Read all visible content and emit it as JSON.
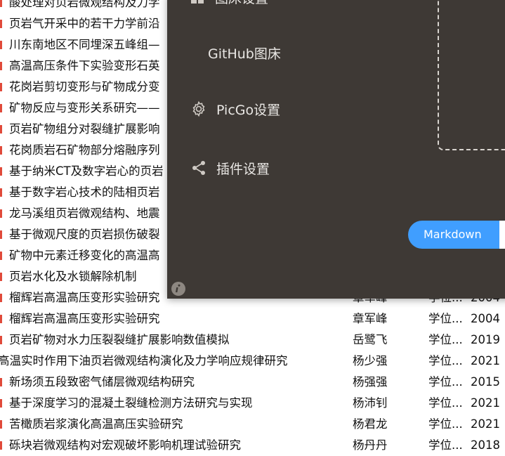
{
  "records": [
    {
      "title": "酸处理对页岩微观结构及力学",
      "author": "",
      "type": "",
      "year": "",
      "partial": true
    },
    {
      "title": "页岩气开采中的若干力学前沿",
      "author": "",
      "type": "",
      "year": "",
      "partial": true
    },
    {
      "title": "川东南地区不同埋深五峰组—",
      "author": "",
      "type": "",
      "year": "",
      "partial": true
    },
    {
      "title": "高温高压条件下实验变形石英",
      "author": "",
      "type": "",
      "year": "",
      "partial": true
    },
    {
      "title": "花岗岩剪切变形与矿物成分变",
      "author": "",
      "type": "",
      "year": "",
      "partial": true
    },
    {
      "title": "矿物反应与变形关系研究——",
      "author": "",
      "type": "",
      "year": "",
      "partial": true
    },
    {
      "title": "页岩矿物组分对裂缝扩展影响",
      "author": "",
      "type": "",
      "year": "",
      "partial": true
    },
    {
      "title": "花岗质岩石矿物部分熔融序列",
      "author": "",
      "type": "",
      "year": "",
      "partial": true
    },
    {
      "title": "基于纳米CT及数字岩心的页岩",
      "author": "",
      "type": "",
      "year": "",
      "partial": true
    },
    {
      "title": "基于数字岩心技术的陆相页岩",
      "author": "",
      "type": "",
      "year": "",
      "partial": true
    },
    {
      "title": "龙马溪组页岩微观结构、地震",
      "author": "",
      "type": "",
      "year": "",
      "partial": true
    },
    {
      "title": "基于微观尺度的页岩损伤破裂",
      "author": "",
      "type": "",
      "year": "",
      "partial": true
    },
    {
      "title": "矿物中元素迁移变化的高温高",
      "author": "",
      "type": "",
      "year": "",
      "partial": true
    },
    {
      "title": "页岩水化及水锁解除机制",
      "author": "",
      "type": "",
      "year": "",
      "partial": true
    },
    {
      "title": "榴辉岩高温高压变形实验研究",
      "author": "章军峰",
      "type": "学位...",
      "year": "2004",
      "partial": false
    },
    {
      "title": "榴辉岩高温高压变形实验研究",
      "author": "章军峰",
      "type": "学位...",
      "year": "2004",
      "partial": false
    },
    {
      "title": "页岩矿物对水力压裂裂缝扩展影响数值模拟",
      "author": "岳鹭飞",
      "type": "学位...",
      "year": "2019",
      "partial": false
    },
    {
      "title": "高温实时作用下油页岩微观结构演化及力学响应规律研究",
      "author": "杨少强",
      "type": "学位...",
      "year": "2021",
      "partial": false,
      "full": true
    },
    {
      "title": "新场须五段致密气储层微观结构研究",
      "author": "杨强强",
      "type": "学位...",
      "year": "2015",
      "partial": false
    },
    {
      "title": "基于深度学习的混凝土裂缝检测方法研究与实现",
      "author": "杨沛钊",
      "type": "学位...",
      "year": "2021",
      "partial": false
    },
    {
      "title": "苦橄质岩浆演化高温高压实验研究",
      "author": "杨君龙",
      "type": "学位...",
      "year": "2021",
      "partial": false
    },
    {
      "title": "砾块岩微观结构对宏观破坏影响机理试验研究",
      "author": "杨丹丹",
      "type": "学位...",
      "year": "2018",
      "partial": false
    }
  ],
  "picgo": {
    "menu": {
      "bed_settings": "图床设置",
      "github_bed": "GitHub图床",
      "picgo_settings": "PicGo设置",
      "plugin_settings": "插件设置"
    },
    "markdown_button": "Markdown",
    "colors": {
      "accent": "#409eff",
      "panel": "#3e3935"
    },
    "icons": [
      "grid-icon",
      "gear-icon",
      "share-icon",
      "info-icon"
    ]
  }
}
